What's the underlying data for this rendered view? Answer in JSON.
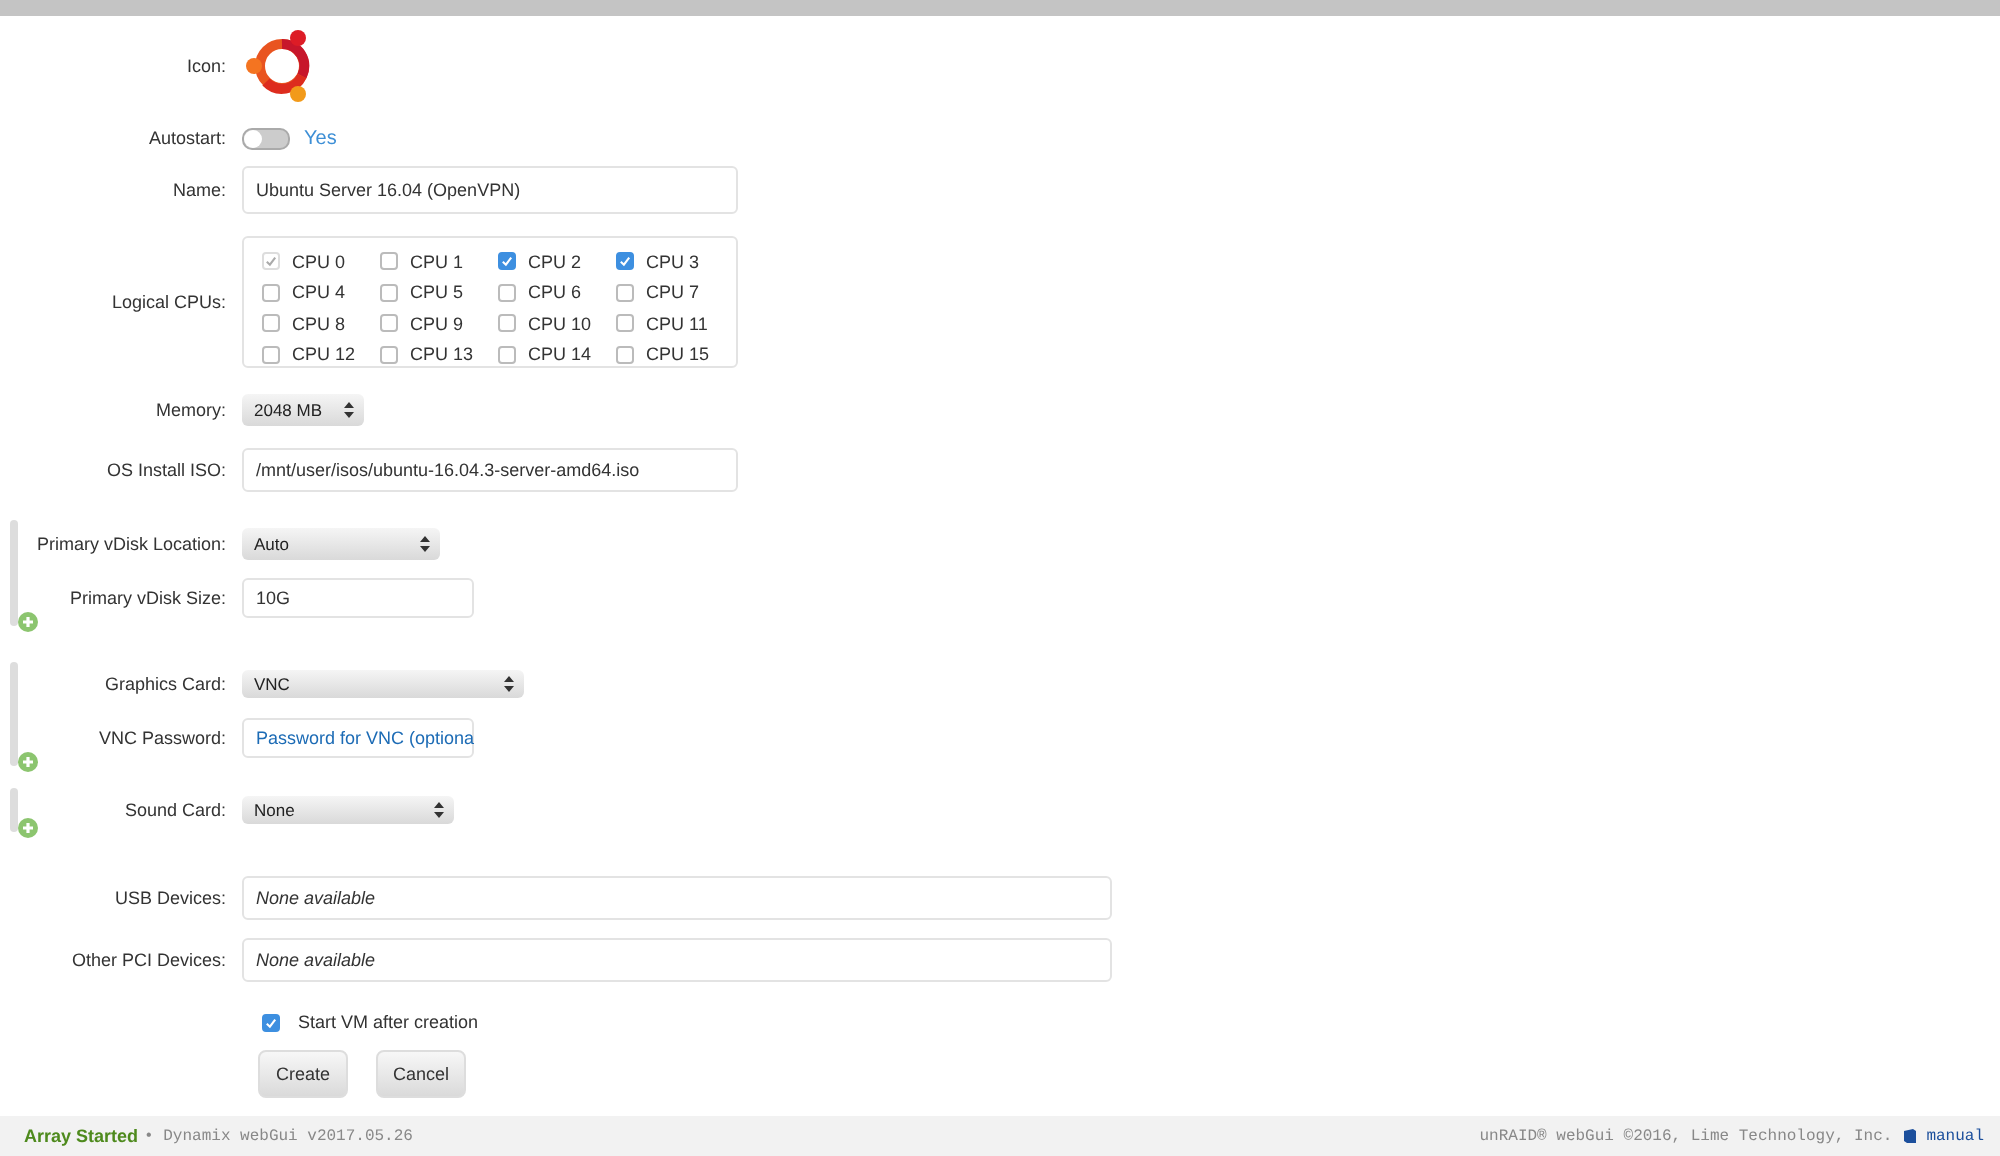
{
  "groups": [
    {
      "addable": false,
      "fields": [
        {
          "kind": "icon",
          "label": "Icon:"
        },
        {
          "kind": "toggle",
          "label": "Autostart:",
          "on": false,
          "value": "Yes"
        },
        {
          "kind": "text",
          "label": "Name:",
          "value": "Ubuntu Server 16.04 (OpenVPN)"
        },
        {
          "kind": "cpus",
          "label": "Logical CPUs:",
          "cpus": [
            {
              "name": "CPU 0",
              "checked": true,
              "disabled": true
            },
            {
              "name": "CPU 1",
              "checked": false,
              "disabled": false
            },
            {
              "name": "CPU 2",
              "checked": true,
              "disabled": false
            },
            {
              "name": "CPU 3",
              "checked": true,
              "disabled": false
            },
            {
              "name": "CPU 4",
              "checked": false,
              "disabled": false
            },
            {
              "name": "CPU 5",
              "checked": false,
              "disabled": false
            },
            {
              "name": "CPU 6",
              "checked": false,
              "disabled": false
            },
            {
              "name": "CPU 7",
              "checked": false,
              "disabled": false
            },
            {
              "name": "CPU 8",
              "checked": false,
              "disabled": false
            },
            {
              "name": "CPU 9",
              "checked": false,
              "disabled": false
            },
            {
              "name": "CPU 10",
              "checked": false,
              "disabled": false
            },
            {
              "name": "CPU 11",
              "checked": false,
              "disabled": false
            },
            {
              "name": "CPU 12",
              "checked": false,
              "disabled": false
            },
            {
              "name": "CPU 13",
              "checked": false,
              "disabled": false
            },
            {
              "name": "CPU 14",
              "checked": false,
              "disabled": false
            },
            {
              "name": "CPU 15",
              "checked": false,
              "disabled": false
            }
          ]
        },
        {
          "kind": "select",
          "label": "Memory:",
          "value": "2048 MB"
        },
        {
          "kind": "text",
          "label": "OS Install ISO:",
          "value": "/mnt/user/isos/ubuntu-16.04.3-server-amd64.iso"
        }
      ]
    },
    {
      "addable": true,
      "fields": [
        {
          "kind": "select",
          "label": "Primary vDisk Location:",
          "value": "Auto"
        },
        {
          "kind": "text",
          "label": "Primary vDisk Size:",
          "value": "10G"
        }
      ]
    },
    {
      "addable": true,
      "fields": [
        {
          "kind": "select",
          "label": "Graphics Card:",
          "value": "VNC"
        },
        {
          "kind": "password",
          "label": "VNC Password:",
          "placeholder": "Password for VNC (optiona"
        }
      ]
    },
    {
      "addable": true,
      "fields": [
        {
          "kind": "select",
          "label": "Sound Card:",
          "value": "None"
        }
      ]
    },
    {
      "addable": false,
      "fields": [
        {
          "kind": "readonly",
          "label": "USB Devices:",
          "value": "None available"
        },
        {
          "kind": "readonly",
          "label": "Other PCI Devices:",
          "value": "None available"
        }
      ]
    }
  ],
  "start_after_creation": {
    "label": "Start VM after creation",
    "checked": true
  },
  "buttons": [
    "Create",
    "Cancel"
  ],
  "status_bar": {
    "state": "Array Started",
    "version": "• Dynamix webGui v2017.05.26",
    "copyright": "unRAID® webGui ©2016, Lime Technology, Inc.",
    "link": "manual"
  }
}
